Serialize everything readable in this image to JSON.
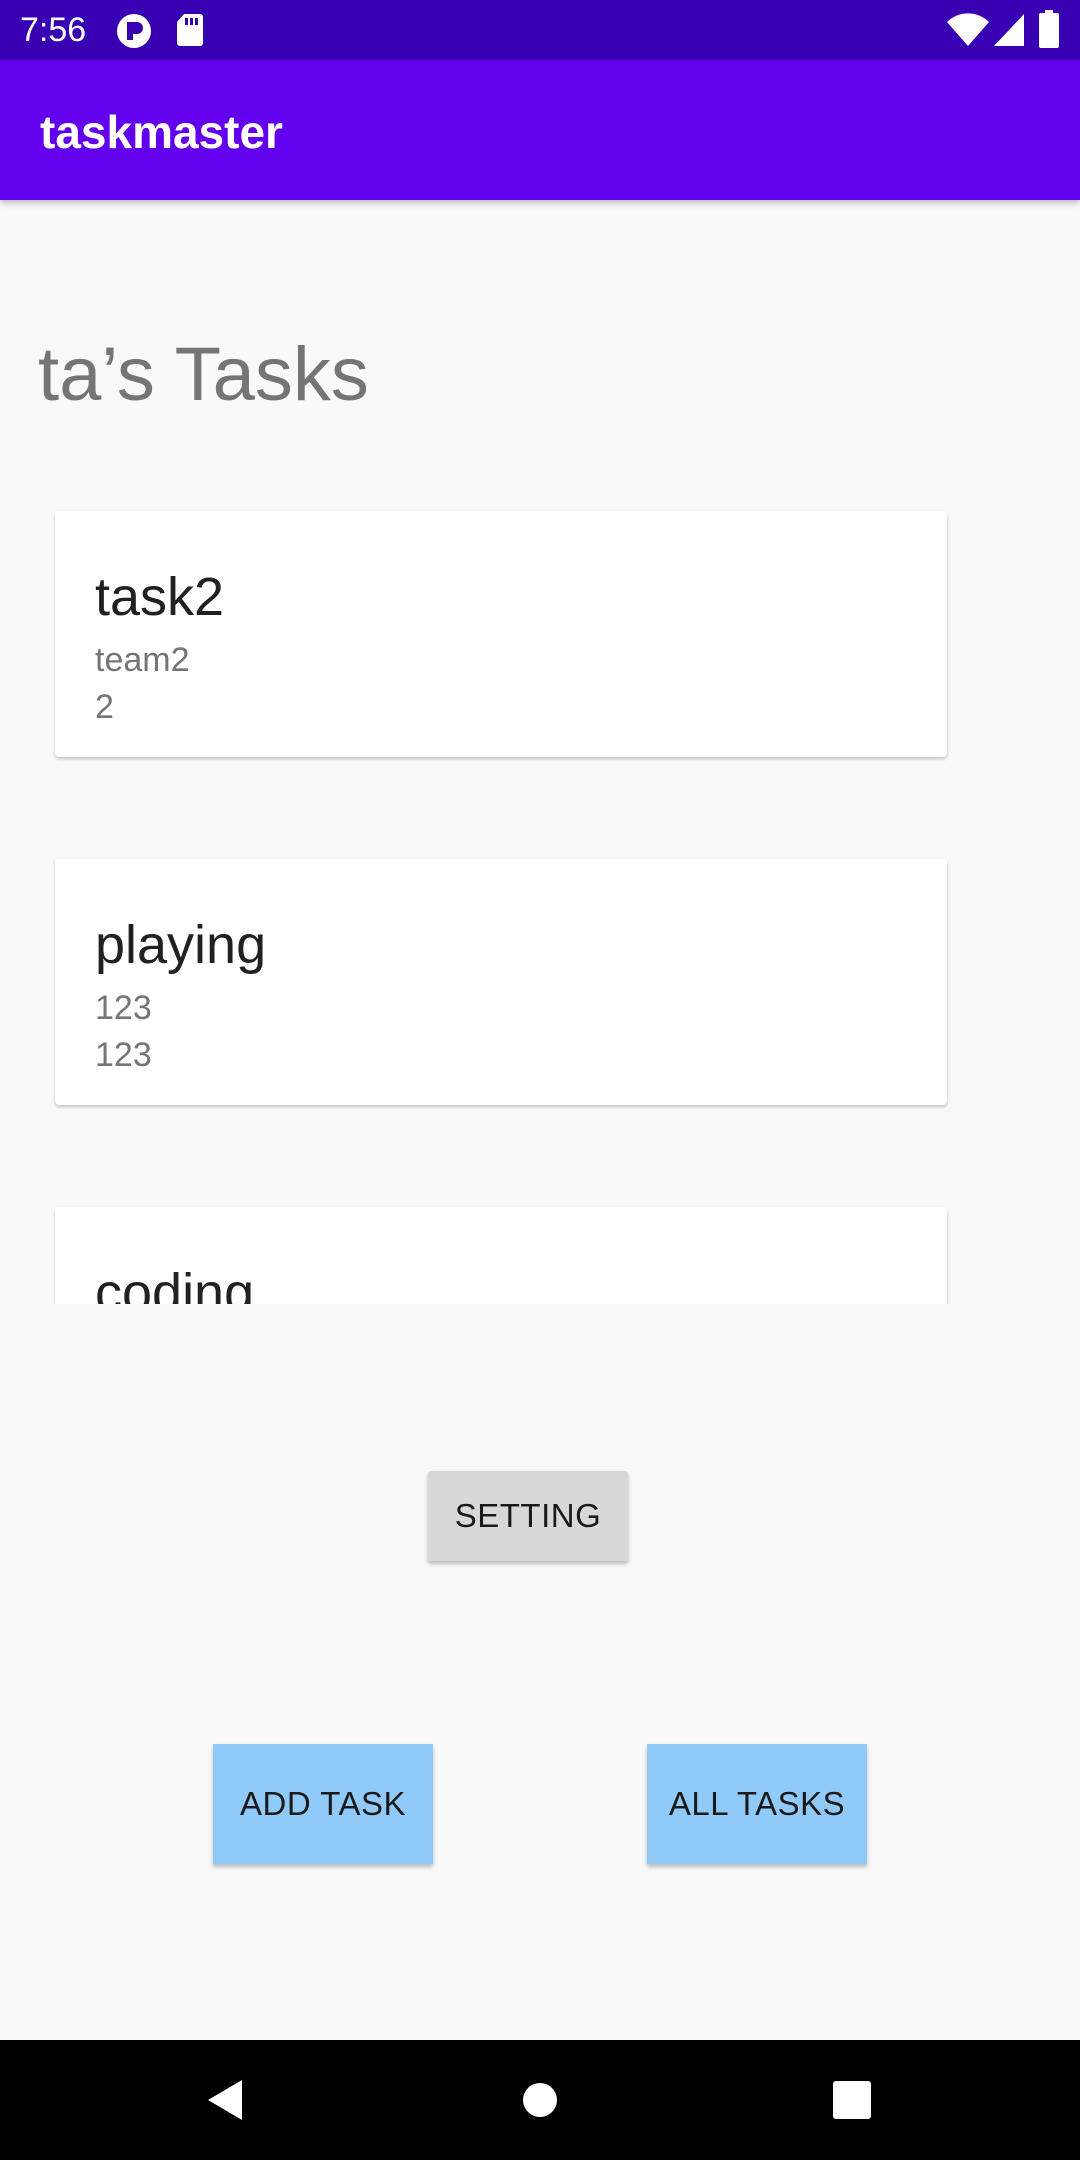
{
  "status_bar": {
    "time": "7:56",
    "icons": [
      "notification-app-icon",
      "sd-card-icon",
      "wifi-icon",
      "cellular-signal-icon",
      "battery-icon"
    ],
    "background": "#3700b3"
  },
  "app_bar": {
    "title": "taskmaster",
    "background": "#6200ee"
  },
  "main": {
    "heading": "ta’s Tasks",
    "tasks": [
      {
        "title": "task2",
        "line1": "team2",
        "line2": "2"
      },
      {
        "title": "playing",
        "line1": "123",
        "line2": "123"
      },
      {
        "title": "coding",
        "line1": "",
        "line2": ""
      }
    ],
    "setting_label": "SETTING",
    "add_task_label": "ADD TASK",
    "all_tasks_label": "ALL TASKS",
    "accent_button_color": "#90caf9"
  },
  "nav_bar": {
    "buttons": [
      "back-icon",
      "home-icon",
      "recents-icon"
    ]
  }
}
